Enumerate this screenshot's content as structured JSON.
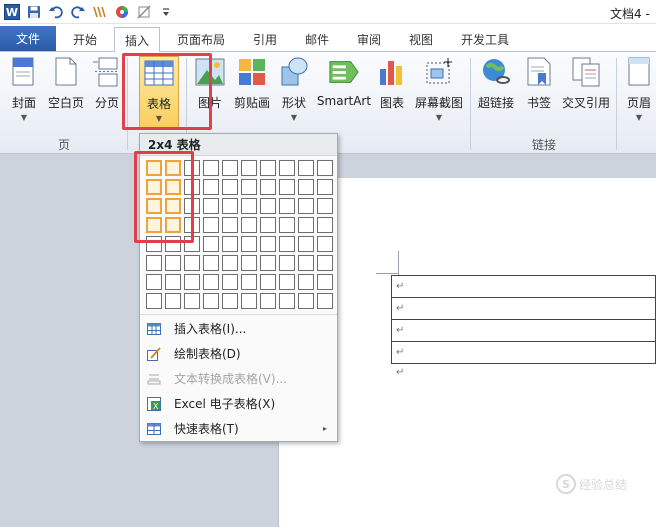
{
  "window": {
    "title": "文档4 -"
  },
  "qat": {
    "word_logo": "W"
  },
  "tabs": [
    {
      "id": "file",
      "label": "文件"
    },
    {
      "id": "home",
      "label": "开始"
    },
    {
      "id": "insert",
      "label": "插入"
    },
    {
      "id": "layout",
      "label": "页面布局"
    },
    {
      "id": "refs",
      "label": "引用"
    },
    {
      "id": "mail",
      "label": "邮件"
    },
    {
      "id": "review",
      "label": "审阅"
    },
    {
      "id": "view",
      "label": "视图"
    },
    {
      "id": "dev",
      "label": "开发工具"
    }
  ],
  "ribbon": {
    "buttons": [
      {
        "id": "cover",
        "label": "封面",
        "icon": "cover-page-icon"
      },
      {
        "id": "blank",
        "label": "空白页",
        "icon": "blank-page-icon"
      },
      {
        "id": "break",
        "label": "分页",
        "icon": "page-break-icon"
      },
      {
        "id": "table",
        "label": "表格",
        "icon": "table-icon"
      },
      {
        "id": "picture",
        "label": "图片",
        "icon": "picture-icon"
      },
      {
        "id": "clipart",
        "label": "剪贴画",
        "icon": "clip-art-icon"
      },
      {
        "id": "shapes",
        "label": "形状",
        "icon": "shapes-icon"
      },
      {
        "id": "smartart",
        "label": "SmartArt",
        "icon": "smartart-icon"
      },
      {
        "id": "chart",
        "label": "图表",
        "icon": "chart-icon"
      },
      {
        "id": "screenshot",
        "label": "屏幕截图",
        "icon": "screenshot-icon"
      },
      {
        "id": "hyperlink",
        "label": "超链接",
        "icon": "hyperlink-icon"
      },
      {
        "id": "bookmark",
        "label": "书签",
        "icon": "bookmark-icon"
      },
      {
        "id": "crossref",
        "label": "交叉引用",
        "icon": "cross-reference-icon"
      },
      {
        "id": "header",
        "label": "页眉",
        "icon": "header-icon"
      }
    ],
    "groups": {
      "pages": "页",
      "links": "链接"
    }
  },
  "table_menu": {
    "header": "2x4 表格",
    "grid_columns": 10,
    "grid_rows": 8,
    "selected_columns": 2,
    "selected_rows": 4,
    "items": [
      {
        "label": "插入表格(I)...",
        "icon": "insert-table-icon",
        "enabled": true
      },
      {
        "label": "绘制表格(D)",
        "icon": "draw-table-icon",
        "enabled": true
      },
      {
        "label": "文本转换成表格(V)...",
        "icon": "convert-text-icon",
        "enabled": false
      },
      {
        "label": "Excel 电子表格(X)",
        "icon": "excel-icon",
        "enabled": true
      },
      {
        "label": "快速表格(T)",
        "icon": "quick-table-icon",
        "enabled": true,
        "submenu": "▸"
      }
    ]
  },
  "document": {
    "table_rows": [
      "↵",
      "↵",
      "↵",
      "↵"
    ],
    "paragraph_mark": "↵"
  },
  "watermark": {
    "text": "经验总结"
  },
  "colors": {
    "annotation_red": "#e0404a",
    "grid_highlight": "#f0a23b",
    "file_tab_blue": "#2a5aa8"
  }
}
